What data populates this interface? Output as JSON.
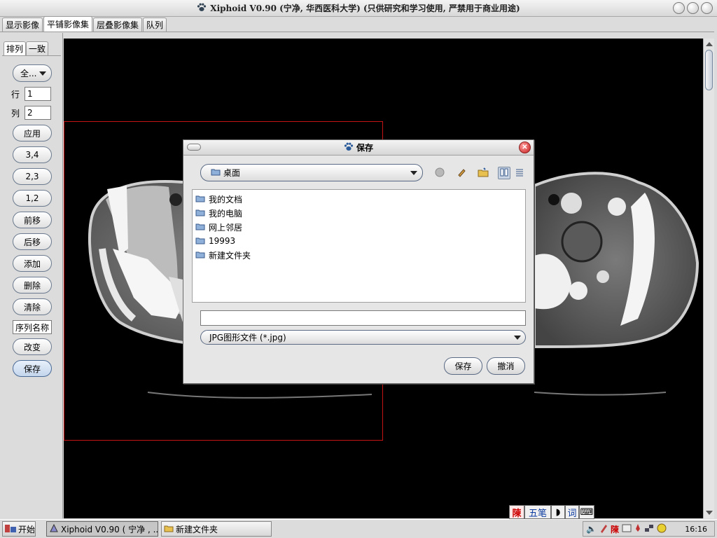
{
  "window": {
    "title": "Xiphoid V0.90 (宁净, 华西医科大学) (只供研究和学习使用, 严禁用于商业用途)"
  },
  "tabs": [
    {
      "label": "显示影像"
    },
    {
      "label": "平铺影像集"
    },
    {
      "label": "层叠影像集"
    },
    {
      "label": "队列"
    }
  ],
  "side": {
    "tabs": [
      {
        "label": "排列"
      },
      {
        "label": "一致"
      }
    ],
    "combo_value": "全...",
    "row_label": "行",
    "row_value": "1",
    "col_label": "列",
    "col_value": "2",
    "buttons": {
      "apply": "应用",
      "l34": "3,4",
      "l23": "2,3",
      "l12": "1,2",
      "forward": "前移",
      "back": "后移",
      "add": "添加",
      "delete": "删除",
      "clear": "清除",
      "change": "改变",
      "save": "保存"
    },
    "seq_name": "序列名称"
  },
  "dialog": {
    "title": "保存",
    "look_in": "桌面",
    "files": [
      {
        "name": "我的文档"
      },
      {
        "name": "我的电脑"
      },
      {
        "name": "网上邻居"
      },
      {
        "name": "19993"
      },
      {
        "name": "新建文件夹"
      }
    ],
    "filename": "",
    "filetype": "JPG图形文件 (*.jpg)",
    "save_label": "保存",
    "cancel_label": "撤消"
  },
  "ime": {
    "chen": "陳",
    "wubi": "五笔",
    "ci": "词"
  },
  "taskbar": {
    "start": "开始",
    "items": [
      {
        "label": "Xiphoid V0.90 ( 宁净 , ..."
      },
      {
        "label": "新建文件夹"
      }
    ],
    "tray_chen": "陳",
    "clock": "16:16"
  }
}
